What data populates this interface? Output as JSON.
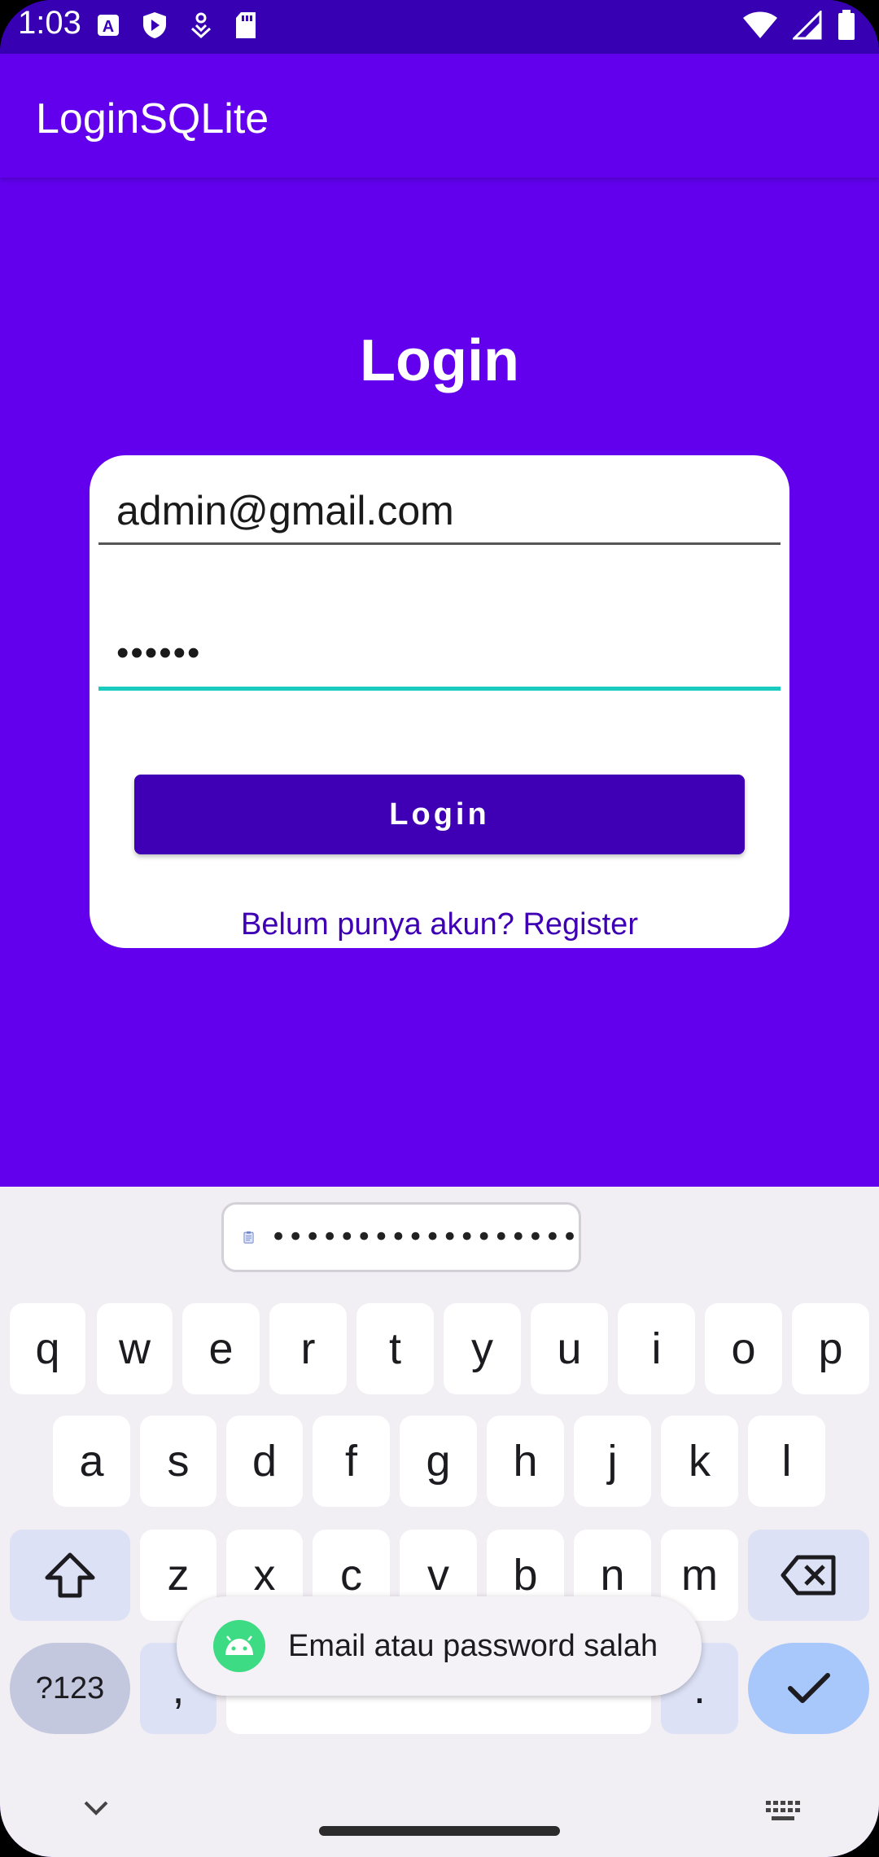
{
  "status_bar": {
    "time": "1:03",
    "icons_left": [
      "autofill-a-icon",
      "shield-play-icon",
      "download-person-icon",
      "sd-card-icon"
    ],
    "icons_right": [
      "wifi-icon",
      "cell-signal-icon",
      "battery-icon"
    ]
  },
  "app_bar": {
    "title": "LoginSQLite"
  },
  "main": {
    "title": "Login",
    "email_value": "admin@gmail.com",
    "password_value": "••••••",
    "login_button_label": "Login",
    "register_link": "Belum punya akun? Register"
  },
  "keyboard": {
    "clipboard_suggestion": "••••••••••••••••••",
    "row1": [
      "q",
      "w",
      "e",
      "r",
      "t",
      "y",
      "u",
      "i",
      "o",
      "p"
    ],
    "row2": [
      "a",
      "s",
      "d",
      "f",
      "g",
      "h",
      "j",
      "k",
      "l"
    ],
    "row3": [
      "z",
      "x",
      "c",
      "v",
      "b",
      "n",
      "m"
    ],
    "symbols_label": "?123",
    "comma_label": ",",
    "period_label": "."
  },
  "toast": {
    "message": "Email atau password salah"
  },
  "colors": {
    "primary": "#6200EE",
    "primary_dark": "#3700B3",
    "button": "#3F00B5",
    "focus_underline": "#1ACBBF"
  }
}
